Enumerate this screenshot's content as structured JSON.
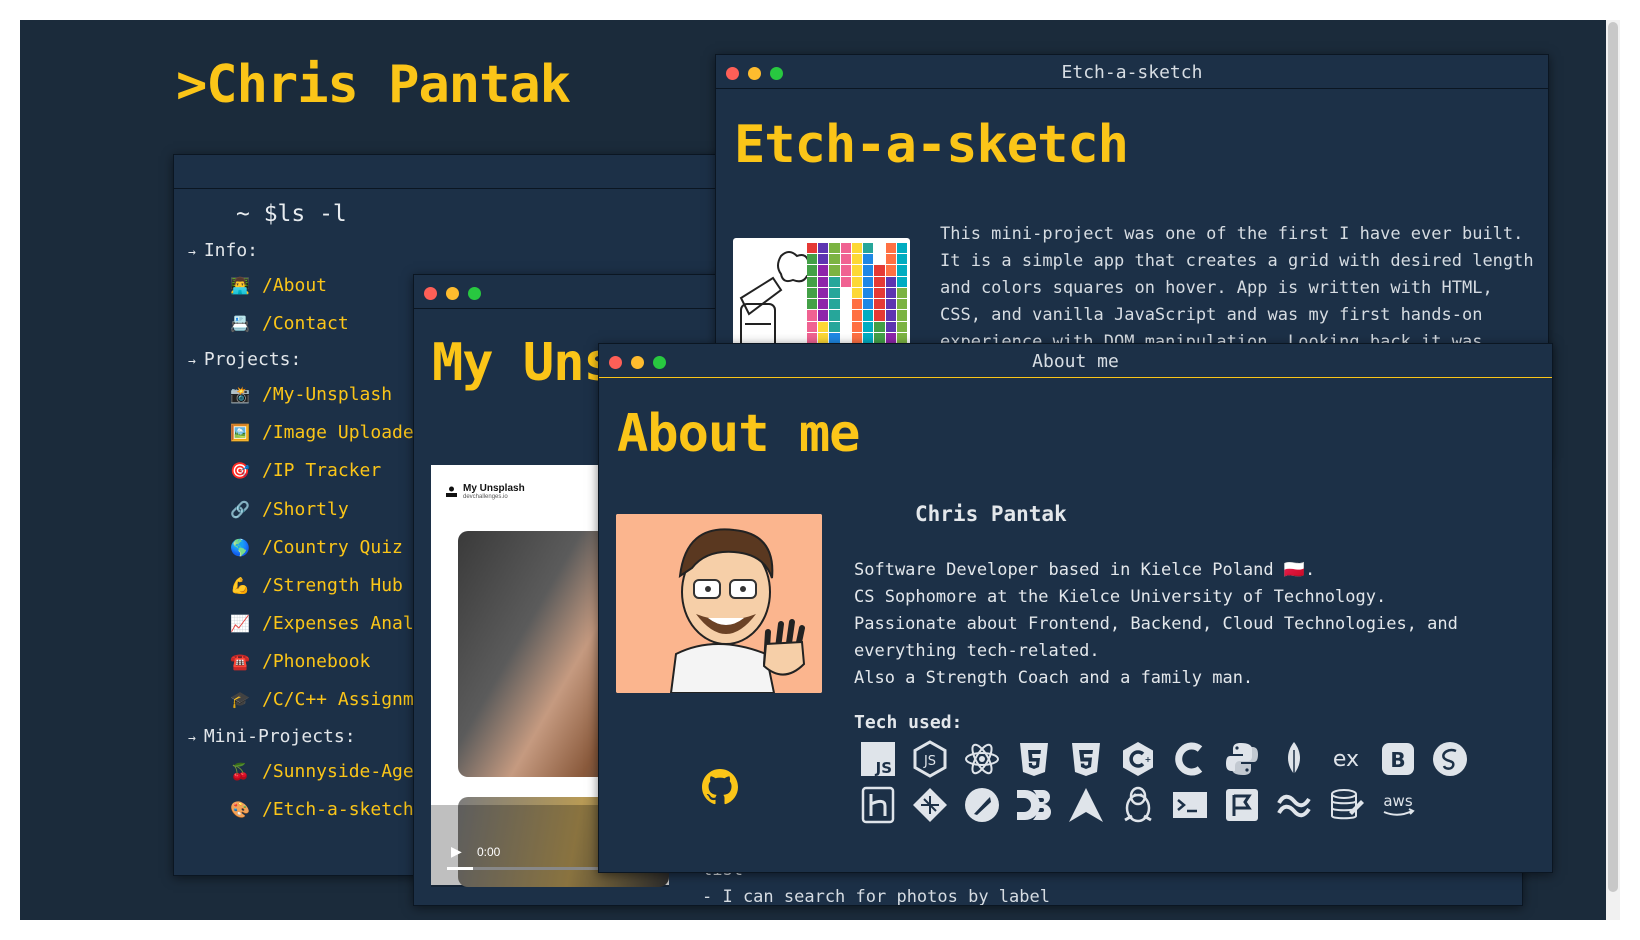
{
  "site": {
    "title": ">Chris Pantak"
  },
  "terminal": {
    "prompt": "~ $ls -l",
    "sections": [
      {
        "label": "Info:",
        "items": [
          {
            "emoji": "👨‍💻",
            "label": "/About"
          },
          {
            "emoji": "📇",
            "label": "/Contact"
          }
        ]
      },
      {
        "label": "Projects:",
        "items": [
          {
            "emoji": "📸",
            "label": "/My-Unsplash"
          },
          {
            "emoji": "🖼️",
            "label": "/Image Uploader"
          },
          {
            "emoji": "🎯",
            "label": "/IP Tracker"
          },
          {
            "emoji": "🔗",
            "label": "/Shortly"
          },
          {
            "emoji": "🌎",
            "label": "/Country Quiz"
          },
          {
            "emoji": "💪",
            "label": "/Strength Hub"
          },
          {
            "emoji": "📈",
            "label": "/Expenses Analy"
          },
          {
            "emoji": "☎️",
            "label": "/Phonebook"
          },
          {
            "emoji": "🎓",
            "label": "/C/C++ Assignme"
          }
        ]
      },
      {
        "label": "Mini-Projects:",
        "items": [
          {
            "emoji": "🍒",
            "label": "/Sunnyside-Agen"
          },
          {
            "emoji": "🎨",
            "label": "/Etch-a-sketch"
          }
        ]
      }
    ]
  },
  "unsplash": {
    "heading": "My Uns",
    "logo_title": "My Unsplash",
    "logo_sub": "devchallenges.io",
    "video_time": "0:00",
    "text_lines": [
      "list",
      "- I can search for photos by label"
    ]
  },
  "etch": {
    "title": "Etch-a-sketch",
    "heading": "Etch-a-sketch",
    "paragraph": "This mini-project was one of the first I have ever built. It is a simple app that creates a grid with desired length and colors squares on hover. App is written with HTML, CSS, and vanilla JavaScript and was my first hands-on experience with DOM manipulation. Looking back it was"
  },
  "about": {
    "title": "About me",
    "heading": "About me",
    "name": "Chris Pantak",
    "bio": [
      "Software Developer based in Kielce Poland 🇵🇱.",
      "CS Sophomore at the Kielce University of Technology.",
      "Passionate about Frontend, Backend, Cloud Technologies, and",
      "everything tech-related.",
      "Also a Strength Coach and a family man."
    ],
    "tech_title": "Tech used:",
    "tech_row1": [
      "javascript-icon",
      "nodejs-icon",
      "react-icon",
      "html5-icon",
      "css3-icon",
      "cplusplus-icon",
      "c-icon",
      "python-icon",
      "mongodb-icon",
      "express-icon",
      "bootstrap-icon",
      "sass-icon"
    ],
    "tech_row2": [
      "heroku-icon",
      "netlify-icon",
      "postman-icon",
      "d3-icon",
      "arch-icon",
      "linux-icon",
      "terminal-icon",
      "flask-icon",
      "tailwind-icon",
      "sql-icon",
      "aws-icon"
    ],
    "aws_label": "aws",
    "ex_label": "ex",
    "js_label": "JS"
  },
  "colors": {
    "accent": "#fbc518",
    "background": "#1b2b3b",
    "window": "#1c3047"
  }
}
